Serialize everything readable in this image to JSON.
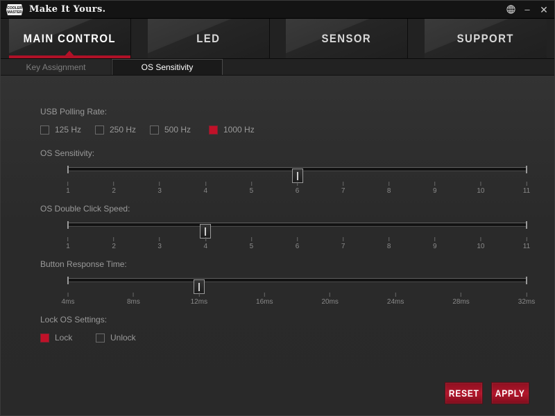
{
  "titlebar": {
    "logo_icon": "cooler-master-logo",
    "title": "Make It Yours.",
    "globe_icon": "globe-icon",
    "minimize_label": "–",
    "close_label": "✕"
  },
  "main_tabs": [
    {
      "label": "MAIN CONTROL",
      "active": true
    },
    {
      "label": "LED",
      "active": false
    },
    {
      "label": "SENSOR",
      "active": false
    },
    {
      "label": "SUPPORT",
      "active": false
    }
  ],
  "sub_tabs": [
    {
      "label": "Key Assignment",
      "active": false
    },
    {
      "label": "OS Sensitivity",
      "active": true
    }
  ],
  "polling": {
    "label": "USB Polling Rate:",
    "options": [
      {
        "label": "125 Hz",
        "checked": false
      },
      {
        "label": "250 Hz",
        "checked": false
      },
      {
        "label": "500 Hz",
        "checked": false
      },
      {
        "label": "1000 Hz",
        "checked": true
      }
    ]
  },
  "os_sensitivity": {
    "label": "OS Sensitivity:",
    "ticks": [
      "1",
      "2",
      "3",
      "4",
      "5",
      "6",
      "7",
      "8",
      "9",
      "10",
      "11"
    ],
    "min": 1,
    "max": 11,
    "value": 6
  },
  "double_click_speed": {
    "label": "OS Double Click Speed:",
    "ticks": [
      "1",
      "2",
      "3",
      "4",
      "5",
      "6",
      "7",
      "8",
      "9",
      "10",
      "11"
    ],
    "min": 1,
    "max": 11,
    "value": 4
  },
  "button_response_time": {
    "label": "Button Response Time:",
    "ticks": [
      "4ms",
      "8ms",
      "12ms",
      "16ms",
      "20ms",
      "24ms",
      "28ms",
      "32ms"
    ],
    "min": 4,
    "max": 32,
    "value": 12
  },
  "lock_settings": {
    "label": "Lock OS Settings:",
    "options": [
      {
        "label": "Lock",
        "checked": true
      },
      {
        "label": "Unlock",
        "checked": false
      }
    ]
  },
  "footer": {
    "reset_label": "RESET",
    "apply_label": "APPLY"
  },
  "colors": {
    "accent_red": "#b01127",
    "checkbox_red": "#c01128",
    "panel_bg": "#2a2a2a",
    "titlebar_bg": "#141414",
    "text_muted": "#9a9a9a"
  }
}
